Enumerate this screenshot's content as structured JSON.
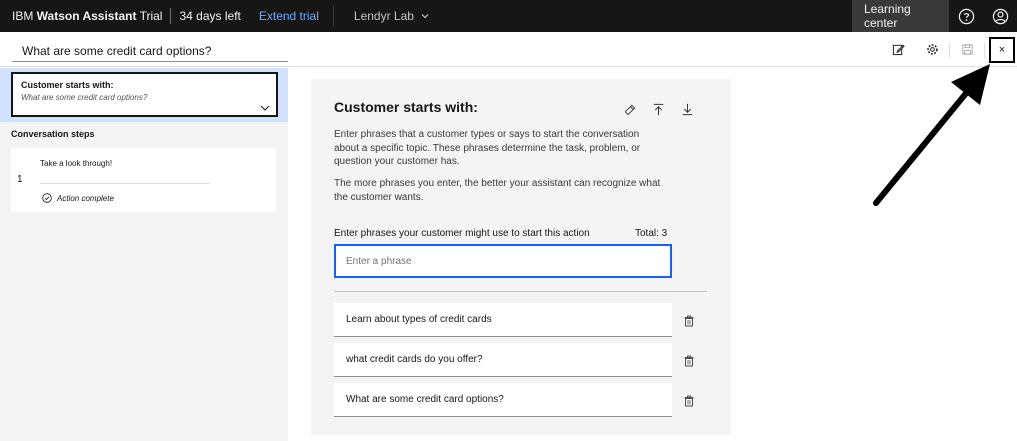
{
  "topbar": {
    "brand_prefix": "IBM ",
    "brand_bold": "Watson Assistant",
    "plan": " Trial",
    "days_left": "34 days left",
    "extend_label": "Extend trial",
    "workspace": "Lendyr Lab",
    "learning_center": "Learning center",
    "icons": [
      "help-icon",
      "user-avatar-icon"
    ]
  },
  "action": {
    "title": "What are some credit card options?",
    "toolbar_icons": [
      "edit-icon",
      "settings-icon",
      "save-icon",
      "close-icon"
    ],
    "close_label": "×"
  },
  "sidebar": {
    "start_label": "Customer starts with:",
    "start_example": "What are some credit card options?",
    "steps_title": "Conversation steps",
    "steps": [
      {
        "number": "1",
        "text": "Take a look through!",
        "status": "Action complete"
      }
    ]
  },
  "panel": {
    "title": "Customer starts with:",
    "icons": [
      "clear-icon",
      "upload-icon",
      "download-icon"
    ],
    "description_1": "Enter phrases that a customer types or says to start the conversation about a specific topic. These phrases determine the task, problem, or question your customer has.",
    "description_2": "The more phrases you enter, the better your assistant can recognize what the customer wants.",
    "input_label": "Enter phrases your customer might use to start this action",
    "total": "Total: 3",
    "input_placeholder": "Enter a phrase",
    "phrases": [
      "Learn about types of credit cards",
      "what credit cards do you offer?",
      "What are some credit card options?"
    ]
  }
}
